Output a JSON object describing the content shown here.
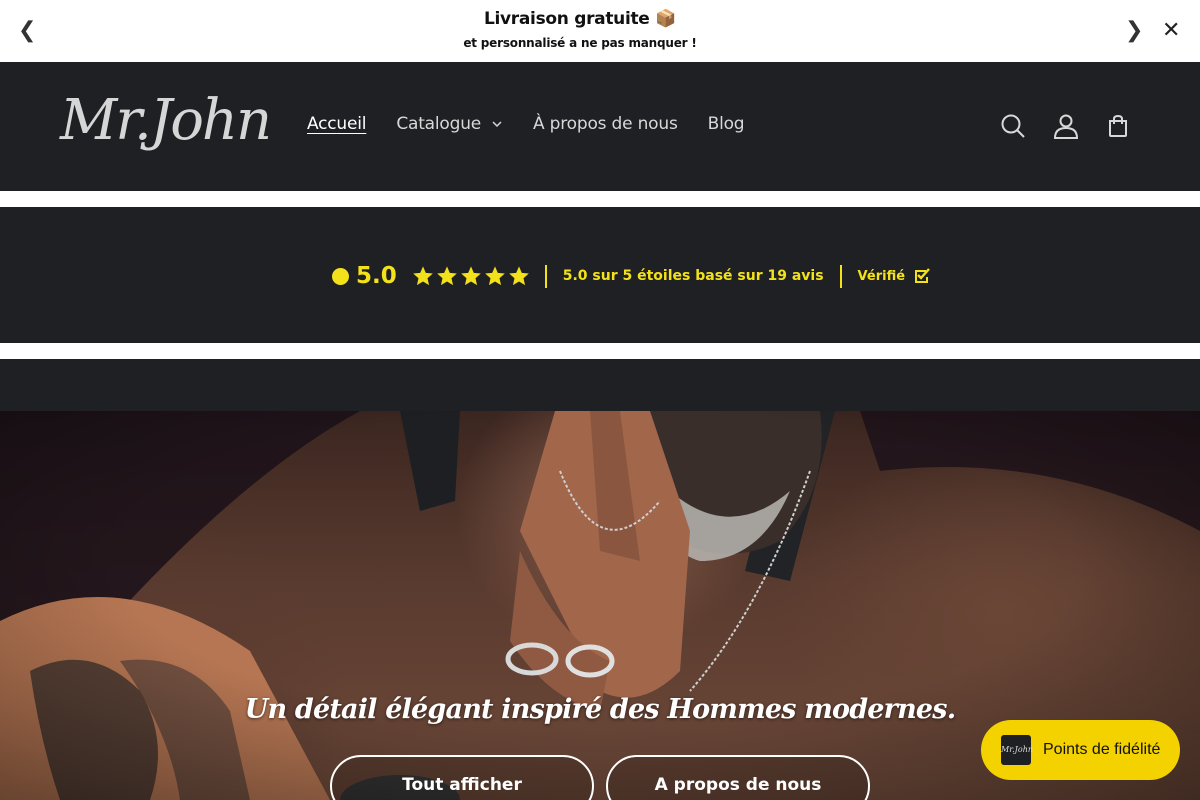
{
  "announcement": {
    "title": "Livraison gratuite 📦",
    "subtitle": "et personnalisé a ne pas manquer !",
    "prev_icon": "❮",
    "next_icon": "❯",
    "close_icon": "✕"
  },
  "header": {
    "logo_text": "Mr.John",
    "nav": {
      "home": "Accueil",
      "catalog": "Catalogue",
      "about": "À propos de nous",
      "blog": "Blog"
    },
    "icons": [
      "search-icon",
      "account-icon",
      "cart-icon"
    ]
  },
  "reviews": {
    "score": "5.0",
    "stars": 5,
    "summary": "5.0 sur 5 étoiles basé sur 19 avis",
    "verified": "Vérifié",
    "accent": "#f3e21a"
  },
  "hero": {
    "title": "Un détail élégant inspiré des Hommes modernes.",
    "button_all": "Tout afficher",
    "button_about": "A propos de nous"
  },
  "loyalty": {
    "logo_text": "Mr.John",
    "label": "Points de fidélité",
    "accent": "#f3d200"
  }
}
